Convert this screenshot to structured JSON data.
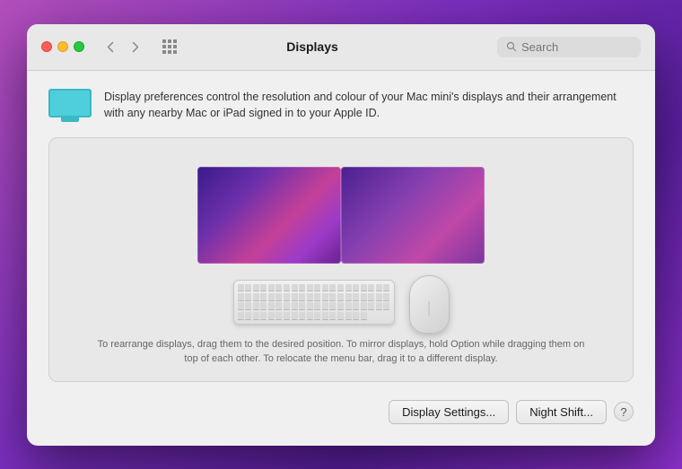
{
  "window": {
    "title": "Displays"
  },
  "titlebar": {
    "back_label": "‹",
    "forward_label": "›"
  },
  "search": {
    "placeholder": "Search"
  },
  "info": {
    "text": "Display preferences control the resolution and colour of your Mac mini's displays and their arrangement with any nearby Mac or iPad signed in to your Apple ID."
  },
  "hint": {
    "text": "To rearrange displays, drag them to the desired position. To mirror displays, hold Option while dragging them on top of each other. To relocate the menu bar, drag it to a different display."
  },
  "buttons": {
    "display_settings": "Display Settings...",
    "night_shift": "Night Shift...",
    "help": "?"
  }
}
